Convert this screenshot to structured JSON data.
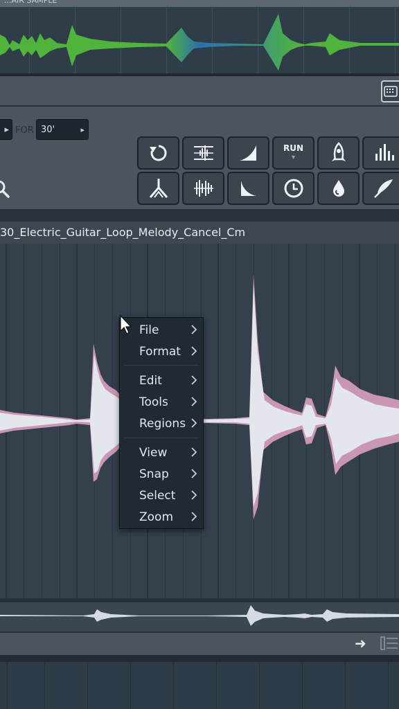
{
  "top_panel": {
    "title": "...AIR SAMPLE"
  },
  "toolbar": {
    "counter_left": "▸",
    "for_label": "FOR",
    "for_value": "30'",
    "for_arrow": "▸",
    "keyboard_icon": "keyboard-icon",
    "buttons_row1": [
      {
        "name": "reverse-icon"
      },
      {
        "name": "normalize-icon"
      },
      {
        "name": "fade-in-icon"
      },
      {
        "name": "run-script-button",
        "label": "RUN"
      },
      {
        "name": "rocket-icon"
      },
      {
        "name": "equalizer-icon"
      }
    ],
    "buttons_row2": [
      {
        "name": "tuning-fork-icon"
      },
      {
        "name": "declick-icon"
      },
      {
        "name": "fade-out-icon"
      },
      {
        "name": "clock-icon"
      },
      {
        "name": "drop-icon"
      },
      {
        "name": "feather-icon"
      }
    ]
  },
  "file": {
    "name": "30_Electric_Guitar_Loop_Melody_Cancel_Cm"
  },
  "context_menu": {
    "items": [
      {
        "label": "File"
      },
      {
        "label": "Format"
      },
      {
        "label": "Edit"
      },
      {
        "label": "Tools"
      },
      {
        "label": "Regions"
      },
      {
        "label": "View"
      },
      {
        "label": "Snap"
      },
      {
        "label": "Select"
      },
      {
        "label": "Zoom"
      }
    ]
  },
  "colors": {
    "waveform_fill": "#e4e6ee",
    "waveform_edge": "#c996b4",
    "top_wave_green": "#4fb33c",
    "top_wave_blue": "#2b6fb0",
    "background": "#34404c"
  }
}
